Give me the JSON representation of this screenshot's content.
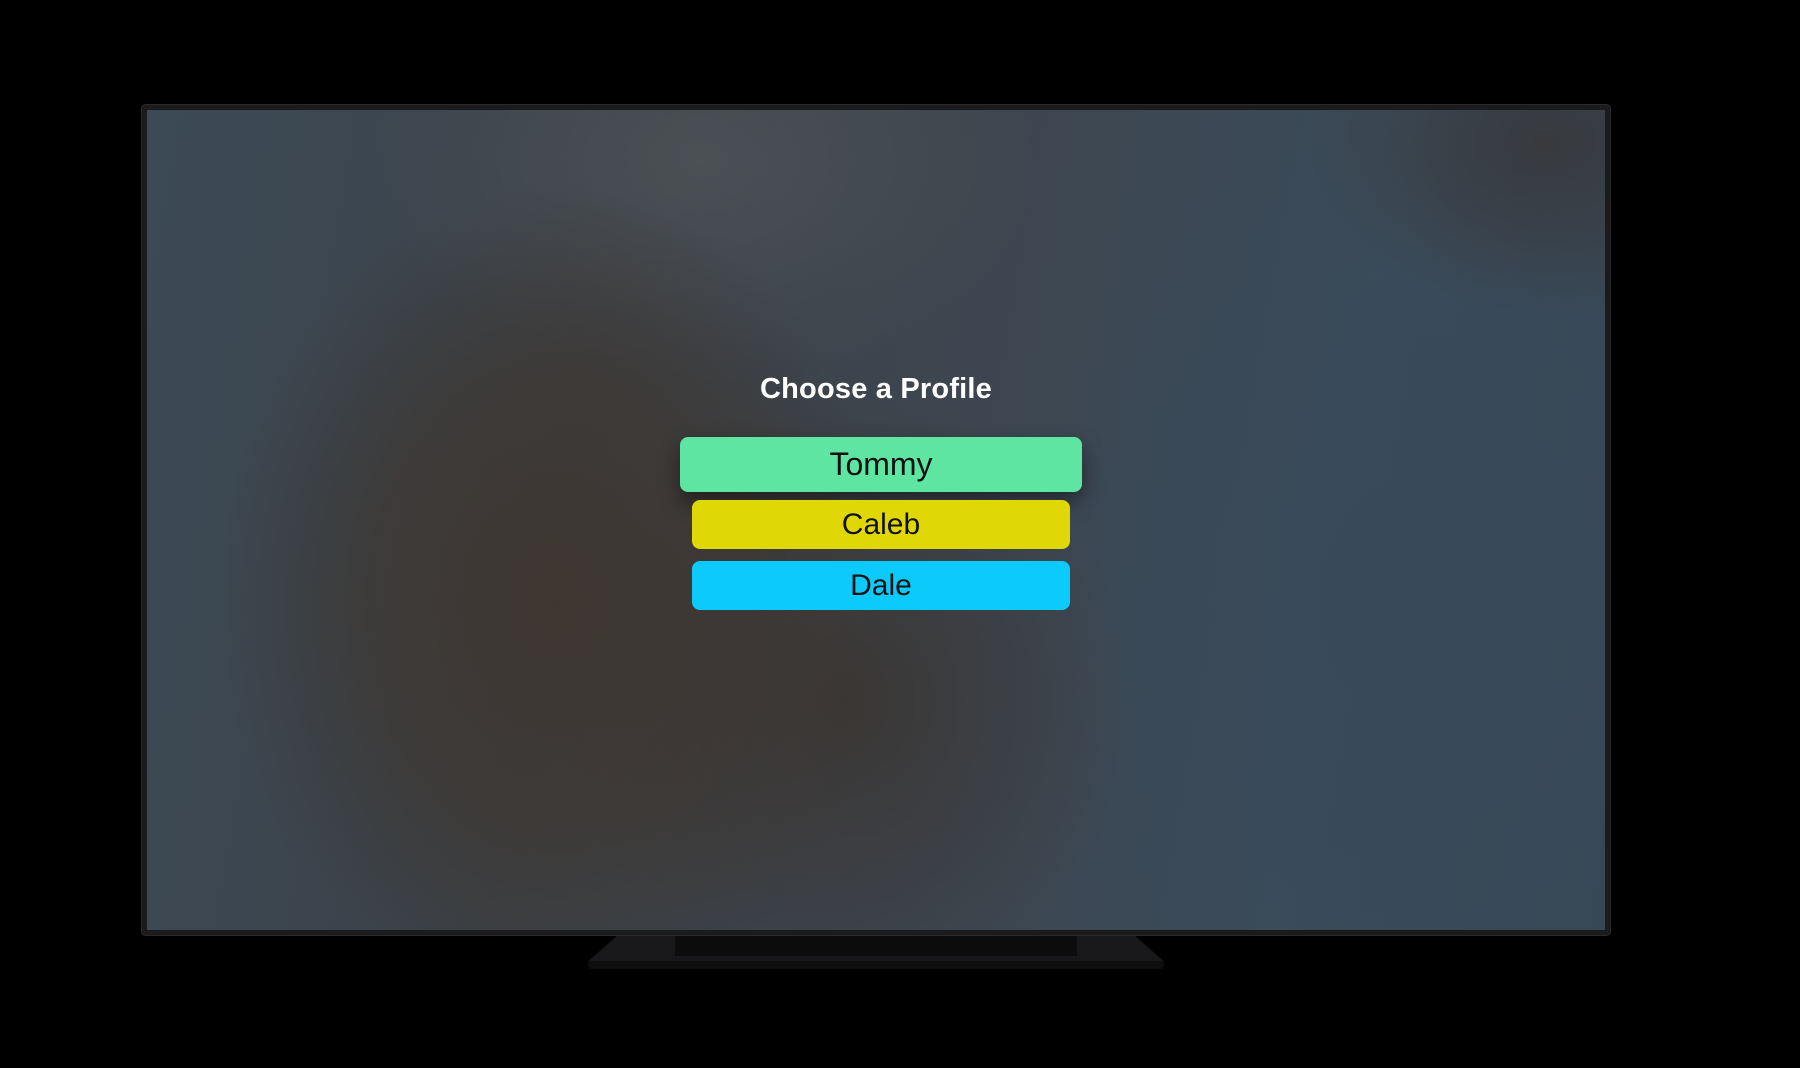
{
  "screen": {
    "title": "Choose a Profile",
    "profiles": [
      {
        "name": "Tommy",
        "color": "#5de5a1",
        "focused": true
      },
      {
        "name": "Caleb",
        "color": "#e0d806",
        "focused": false
      },
      {
        "name": "Dale",
        "color": "#0ccbfc",
        "focused": false
      }
    ]
  },
  "colors": {
    "background": "#000000",
    "bezel": "#1b1b1c",
    "text_on_button": "#111111",
    "title_text": "#ffffff"
  }
}
